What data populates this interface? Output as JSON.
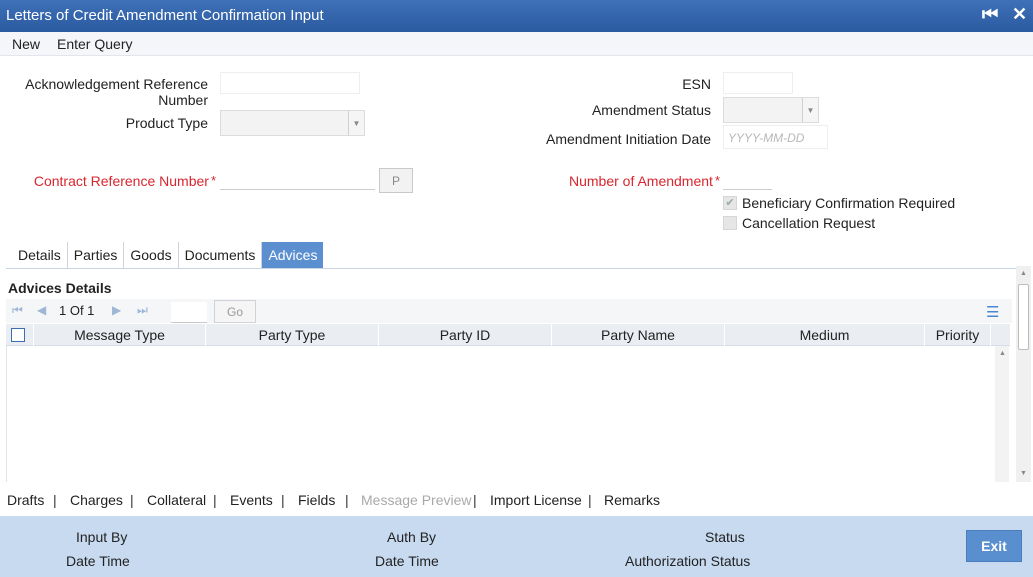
{
  "window": {
    "title": "Letters of Credit Amendment Confirmation Input",
    "minimize": "▬",
    "close": "✕"
  },
  "menu": {
    "new": "New",
    "enter_query": "Enter Query"
  },
  "form": {
    "ack_ref_label_1": "Acknowledgement Reference",
    "ack_ref_label_2": "Number",
    "product_type_label": "Product Type",
    "esn_label": "ESN",
    "amendment_status_label": "Amendment Status",
    "amendment_initiation_label": "Amendment Initiation Date",
    "amendment_initiation_placeholder": "YYYY-MM-DD",
    "contract_ref_label": "Contract Reference Number",
    "p_button": "P",
    "number_of_amendment_label": "Number of Amendment",
    "required_mark": "*",
    "beneficiary_confirmation": "Beneficiary Confirmation Required",
    "beneficiary_checked": "✔",
    "cancellation_request": "Cancellation Request"
  },
  "tabs": [
    "Details",
    "Parties",
    "Goods",
    "Documents",
    "Advices"
  ],
  "advices": {
    "title": "Advices Details",
    "pager": "1 Of 1",
    "go": "Go",
    "columns": [
      "Message Type",
      "Party Type",
      "Party ID",
      "Party Name",
      "Medium",
      "Priority"
    ]
  },
  "subsystems": [
    "Drafts",
    "Charges",
    "Collateral",
    "Events",
    "Fields",
    "Message Preview",
    "Import License",
    "Remarks"
  ],
  "separator": "|",
  "footer": {
    "input_by": "Input By",
    "date_time": "Date Time",
    "auth_by": "Auth By",
    "status": "Status",
    "authorization_status": "Authorization Status",
    "exit": "Exit"
  },
  "icons": {
    "combo": "▼",
    "first": "⏮",
    "prev": "◀",
    "next": "▶",
    "last": "⏭",
    "list": "☰",
    "scroll_up": "▲",
    "scroll_down": "▼"
  }
}
